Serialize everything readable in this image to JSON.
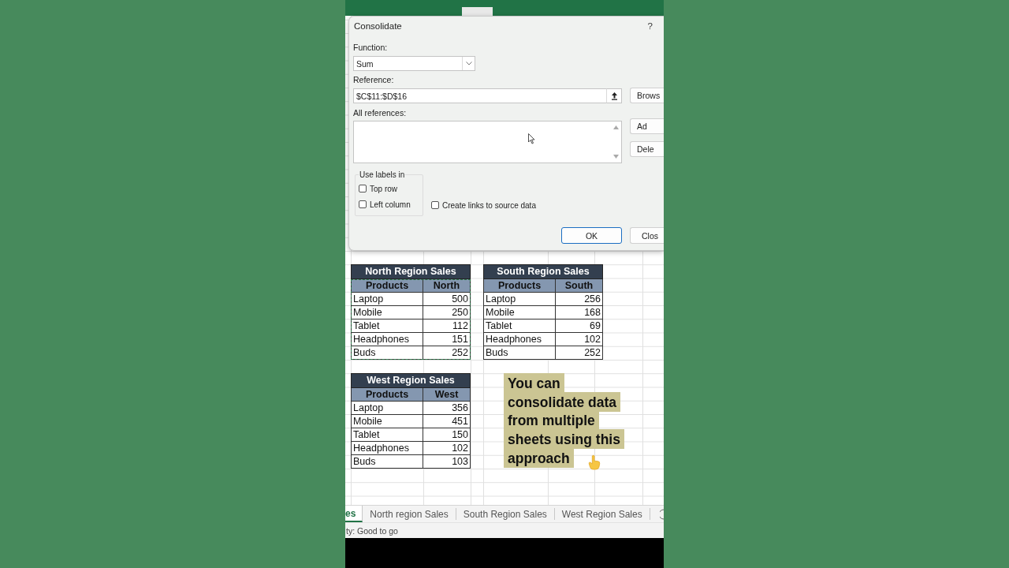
{
  "dialog": {
    "title": "Consolidate",
    "help": "?",
    "function_label": "Function:",
    "function_value": "Sum",
    "reference_label": "Reference:",
    "reference_value": "$C$11:$D$16",
    "all_references_label": "All references:",
    "browse_button": "Brows",
    "add_button": "Ad",
    "delete_button": "Dele",
    "labels_group": "Use labels in",
    "label_options": [
      {
        "label": "Top row",
        "checked": false
      },
      {
        "label": "Left column",
        "checked": false
      }
    ],
    "create_links": {
      "label": "Create links to source data",
      "checked": false
    },
    "ok_button": "OK",
    "close_button": "Clos"
  },
  "tables": [
    {
      "title": "North Region Sales",
      "headers": [
        "Products",
        "North"
      ],
      "marquee": true,
      "rows": [
        [
          "Laptop",
          "500"
        ],
        [
          "Mobile",
          "250"
        ],
        [
          "Tablet",
          "112"
        ],
        [
          "Headphones",
          "151"
        ],
        [
          "Buds",
          "252"
        ]
      ]
    },
    {
      "title": "South Region Sales",
      "headers": [
        "Products",
        "South"
      ],
      "marquee": false,
      "rows": [
        [
          "Laptop",
          "256"
        ],
        [
          "Mobile",
          "168"
        ],
        [
          "Tablet",
          "69"
        ],
        [
          "Headphones",
          "102"
        ],
        [
          "Buds",
          "252"
        ]
      ]
    },
    {
      "title": "West Region Sales",
      "headers": [
        "Products",
        "West"
      ],
      "marquee": false,
      "rows": [
        [
          "Laptop",
          "356"
        ],
        [
          "Mobile",
          "451"
        ],
        [
          "Tablet",
          "150"
        ],
        [
          "Headphones",
          "102"
        ],
        [
          "Buds",
          "103"
        ]
      ]
    }
  ],
  "caption": {
    "lines": [
      "You can",
      "consolidate data",
      "from multiple",
      "sheets using this",
      "approach"
    ]
  },
  "sheet_tabs": [
    {
      "label": "es",
      "selected": true
    },
    {
      "label": "North region Sales",
      "selected": false
    },
    {
      "label": "South Region Sales",
      "selected": false
    },
    {
      "label": "West Region Sales",
      "selected": false
    }
  ],
  "status_bar": "ty: Good to go"
}
